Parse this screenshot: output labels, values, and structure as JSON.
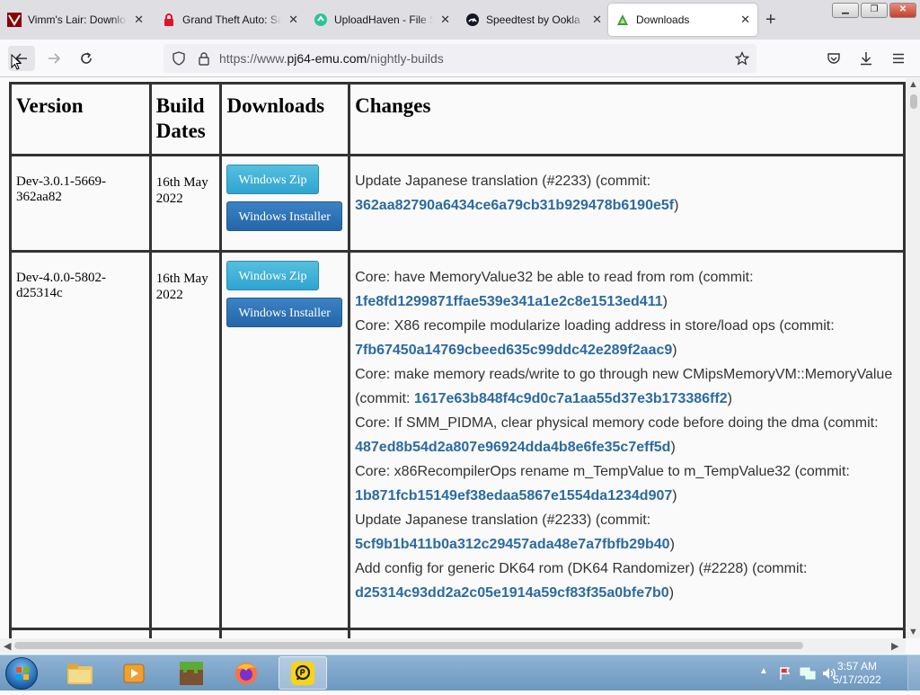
{
  "tabs": [
    {
      "title": "Vimm's Lair: Download",
      "icon": "vimm-icon"
    },
    {
      "title": "Grand Theft Auto: San Andreas",
      "icon": "lock-icon"
    },
    {
      "title": "UploadHaven - File Sharing",
      "icon": "uploadhaven-icon"
    },
    {
      "title": "Speedtest by Ookla - The Global",
      "icon": "speedtest-icon"
    },
    {
      "title": "Downloads",
      "icon": "pj64-icon"
    }
  ],
  "url": {
    "prefix": "https://www.",
    "domain": "pj64-emu.com",
    "path": "/nightly-builds"
  },
  "table": {
    "headers": {
      "version": "Version",
      "build_dates": "Build Dates",
      "downloads": "Downloads",
      "changes": "Changes"
    },
    "rows": [
      {
        "version": "Dev-3.0.1-5669-362aa82",
        "date": "16th May 2022",
        "zip_label": "Windows Zip",
        "installer_label": "Windows Installer",
        "changes": [
          {
            "text": "Update Japanese translation (#2233) (commit:",
            "commit": "362aa82790a6434ce6a79cb31b929478b6190e5f"
          }
        ]
      },
      {
        "version": "Dev-4.0.0-5802-d25314c",
        "date": "16th May 2022",
        "zip_label": "Windows Zip",
        "installer_label": "Windows Installer",
        "changes": [
          {
            "text": "Core: have MemoryValue32 be able to read from rom (commit:",
            "commit": "1fe8fd1299871ffae539e341a1e2c8e1513ed411"
          },
          {
            "text": "Core: X86 recompile modularize loading address in store/load ops (commit:",
            "commit": "7fb67450a14769cbeed635c99ddc42e289f2aac9"
          },
          {
            "text": "Core: make memory reads/write to go through new CMipsMemoryVM::MemoryValue",
            "prefix2": "(commit: ",
            "commit": "1617e63b848f4c9d0c7a1aa55d37e3b173386ff2"
          },
          {
            "text": "Core: If SMM_PIDMA, clear physical memory code before doing the dma (commit:",
            "commit": "487ed8b54d2a807e96924dda4b8e6fe35c7eff5d"
          },
          {
            "text": "Core: x86RecompilerOps rename m_TempValue to m_TempValue32 (commit:",
            "commit": "1b871fcb15149ef38edaa5867e1554da1234d907"
          },
          {
            "text": "Update Japanese translation (#2233) (commit:",
            "commit": "5cf9b1b411b0a312c29457ada48e7a7fbfb29b40"
          },
          {
            "text": "Add config for generic DK64 rom (DK64 Randomizer) (#2228) (commit:",
            "commit": "d25314c93dd2a2c05e1914a59cf83f35a0bfe7b0"
          }
        ]
      }
    ]
  },
  "close_paren": ")",
  "clock": {
    "time": "3:57 AM",
    "date": "5/17/2022"
  },
  "colors": {
    "link": "#2c6aa0",
    "zip_button": "#2fa4cf",
    "installer_button": "#2466a8",
    "taskbar": "#7da6cb"
  }
}
